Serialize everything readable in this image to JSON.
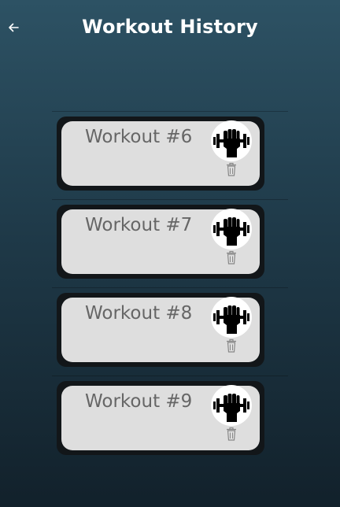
{
  "header": {
    "title": "Workout History",
    "back_icon": "arrow-left-icon"
  },
  "workouts": [
    {
      "label": "Workout #6",
      "icon": "dumbbell-fist-icon",
      "delete_icon": "trash-icon"
    },
    {
      "label": "Workout #7",
      "icon": "dumbbell-fist-icon",
      "delete_icon": "trash-icon"
    },
    {
      "label": "Workout #8",
      "icon": "dumbbell-fist-icon",
      "delete_icon": "trash-icon"
    },
    {
      "label": "Workout #9",
      "icon": "dumbbell-fist-icon",
      "delete_icon": "trash-icon"
    }
  ],
  "colors": {
    "background_top": "#2d5264",
    "background_bottom": "#12212b",
    "card_border": "#121619",
    "card_fill": "#dedede",
    "label_text": "#666666"
  }
}
